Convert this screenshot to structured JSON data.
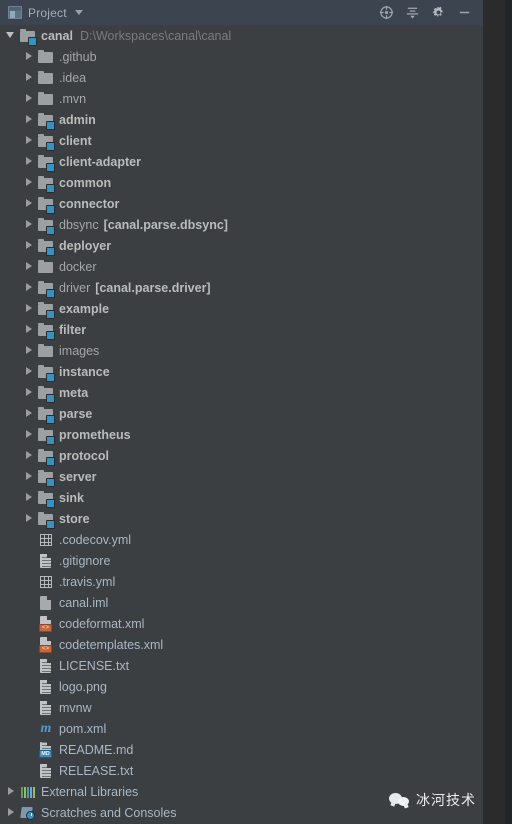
{
  "window": {
    "background_color": "#3C3F41",
    "header_color": "#3C4450",
    "accent_color": "#3592C4",
    "text_color": "#A9B7C6"
  },
  "header": {
    "tab_label": "Project",
    "tab_icon": "project-panel-icon",
    "chevron_icon": "chevron-down-icon",
    "actions": [
      {
        "name": "locate-in-tree-button",
        "icon": "target-crosshair-icon",
        "tooltip": "Select Opened File"
      },
      {
        "name": "collapse-all-button",
        "icon": "collapse-all-icon",
        "tooltip": "Collapse All"
      },
      {
        "name": "settings-button",
        "icon": "gear-icon",
        "tooltip": "Settings"
      },
      {
        "name": "hide-button",
        "icon": "minimize-icon",
        "tooltip": "Hide"
      }
    ]
  },
  "tree": {
    "root": {
      "label": "canal",
      "path": "D:\\Workspaces\\canal\\canal",
      "expanded": true,
      "icon": "project-root-folder-icon"
    },
    "items": [
      {
        "label": ".github",
        "icon": "folder-icon",
        "kind": "folder",
        "expandable": true,
        "bold": false,
        "module": ""
      },
      {
        "label": ".idea",
        "icon": "folder-icon",
        "kind": "folder",
        "expandable": true,
        "bold": false,
        "module": ""
      },
      {
        "label": ".mvn",
        "icon": "folder-icon",
        "kind": "folder",
        "expandable": true,
        "bold": false,
        "module": ""
      },
      {
        "label": "admin",
        "icon": "module-folder-icon",
        "kind": "module",
        "expandable": true,
        "bold": true,
        "module": ""
      },
      {
        "label": "client",
        "icon": "module-folder-icon",
        "kind": "module",
        "expandable": true,
        "bold": true,
        "module": ""
      },
      {
        "label": "client-adapter",
        "icon": "module-folder-icon",
        "kind": "module",
        "expandable": true,
        "bold": true,
        "module": ""
      },
      {
        "label": "common",
        "icon": "module-folder-icon",
        "kind": "module",
        "expandable": true,
        "bold": true,
        "module": ""
      },
      {
        "label": "connector",
        "icon": "module-folder-icon",
        "kind": "module",
        "expandable": true,
        "bold": true,
        "module": ""
      },
      {
        "label": "dbsync",
        "icon": "module-folder-icon",
        "kind": "module",
        "expandable": true,
        "bold": false,
        "module": "[canal.parse.dbsync]"
      },
      {
        "label": "deployer",
        "icon": "module-folder-icon",
        "kind": "module",
        "expandable": true,
        "bold": true,
        "module": ""
      },
      {
        "label": "docker",
        "icon": "folder-icon",
        "kind": "folder",
        "expandable": true,
        "bold": false,
        "module": ""
      },
      {
        "label": "driver",
        "icon": "module-folder-icon",
        "kind": "module",
        "expandable": true,
        "bold": false,
        "module": "[canal.parse.driver]"
      },
      {
        "label": "example",
        "icon": "module-folder-icon",
        "kind": "module",
        "expandable": true,
        "bold": true,
        "module": ""
      },
      {
        "label": "filter",
        "icon": "module-folder-icon",
        "kind": "module",
        "expandable": true,
        "bold": true,
        "module": ""
      },
      {
        "label": "images",
        "icon": "folder-icon",
        "kind": "folder",
        "expandable": true,
        "bold": false,
        "module": ""
      },
      {
        "label": "instance",
        "icon": "module-folder-icon",
        "kind": "module",
        "expandable": true,
        "bold": true,
        "module": ""
      },
      {
        "label": "meta",
        "icon": "module-folder-icon",
        "kind": "module",
        "expandable": true,
        "bold": true,
        "module": ""
      },
      {
        "label": "parse",
        "icon": "module-folder-icon",
        "kind": "module",
        "expandable": true,
        "bold": true,
        "module": ""
      },
      {
        "label": "prometheus",
        "icon": "module-folder-icon",
        "kind": "module",
        "expandable": true,
        "bold": true,
        "module": ""
      },
      {
        "label": "protocol",
        "icon": "module-folder-icon",
        "kind": "module",
        "expandable": true,
        "bold": true,
        "module": ""
      },
      {
        "label": "server",
        "icon": "module-folder-icon",
        "kind": "module",
        "expandable": true,
        "bold": true,
        "module": ""
      },
      {
        "label": "sink",
        "icon": "module-folder-icon",
        "kind": "module",
        "expandable": true,
        "bold": true,
        "module": ""
      },
      {
        "label": "store",
        "icon": "module-folder-icon",
        "kind": "module",
        "expandable": true,
        "bold": true,
        "module": ""
      },
      {
        "label": ".codecov.yml",
        "icon": "yaml-file-icon",
        "kind": "file",
        "expandable": false,
        "bold": false,
        "module": ""
      },
      {
        "label": ".gitignore",
        "icon": "text-file-icon",
        "kind": "file",
        "expandable": false,
        "bold": false,
        "module": ""
      },
      {
        "label": ".travis.yml",
        "icon": "yaml-file-icon",
        "kind": "file",
        "expandable": false,
        "bold": false,
        "module": ""
      },
      {
        "label": "canal.iml",
        "icon": "iml-file-icon",
        "kind": "file",
        "expandable": false,
        "bold": false,
        "module": ""
      },
      {
        "label": "codeformat.xml",
        "icon": "xml-file-icon",
        "kind": "file",
        "expandable": false,
        "bold": false,
        "module": ""
      },
      {
        "label": "codetemplates.xml",
        "icon": "xml-file-icon",
        "kind": "file",
        "expandable": false,
        "bold": false,
        "module": ""
      },
      {
        "label": "LICENSE.txt",
        "icon": "text-file-icon",
        "kind": "file",
        "expandable": false,
        "bold": false,
        "module": ""
      },
      {
        "label": "logo.png",
        "icon": "text-file-icon",
        "kind": "file",
        "expandable": false,
        "bold": false,
        "module": ""
      },
      {
        "label": "mvnw",
        "icon": "text-file-icon",
        "kind": "file",
        "expandable": false,
        "bold": false,
        "module": ""
      },
      {
        "label": "pom.xml",
        "icon": "maven-pom-icon",
        "kind": "file",
        "expandable": false,
        "bold": false,
        "module": ""
      },
      {
        "label": "README.md",
        "icon": "markdown-file-icon",
        "kind": "file",
        "expandable": false,
        "bold": false,
        "module": ""
      },
      {
        "label": "RELEASE.txt",
        "icon": "text-file-icon",
        "kind": "file",
        "expandable": false,
        "bold": false,
        "module": ""
      }
    ],
    "footer_items": [
      {
        "label": "External Libraries",
        "icon": "external-libraries-icon",
        "expandable": true
      },
      {
        "label": "Scratches and Consoles",
        "icon": "scratches-icon",
        "expandable": true
      }
    ]
  },
  "watermark": {
    "text": "冰河技术",
    "icon": "wechat-logo-icon"
  }
}
